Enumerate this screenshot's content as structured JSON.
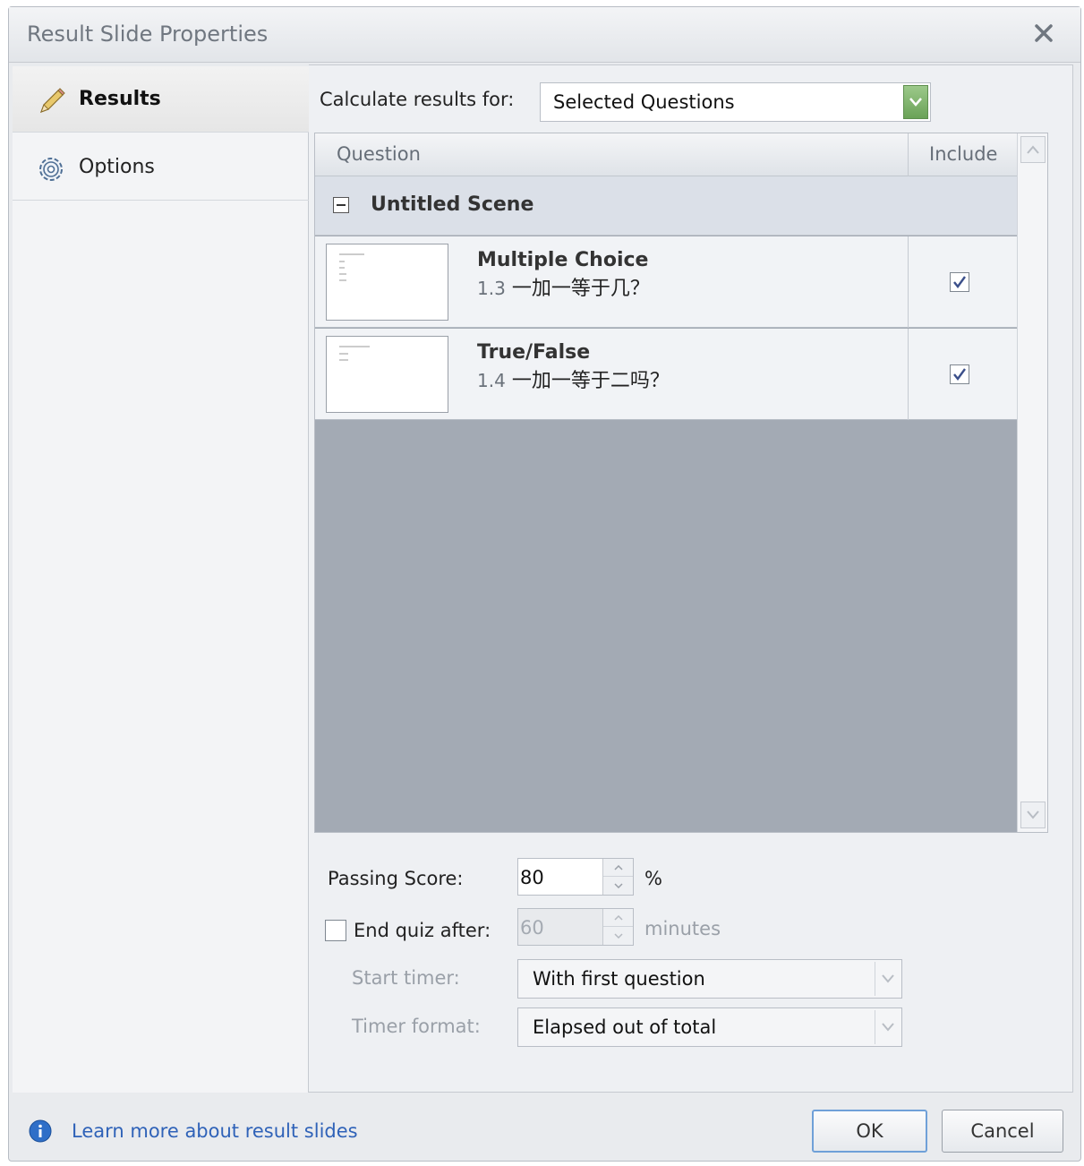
{
  "window": {
    "title": "Result Slide Properties"
  },
  "sidebar": {
    "items": [
      {
        "label": "Results",
        "icon": "pencil-icon",
        "active": true
      },
      {
        "label": "Options",
        "icon": "gear-icon",
        "active": false
      }
    ]
  },
  "calculate": {
    "label": "Calculate results for:",
    "value": "Selected Questions"
  },
  "grid": {
    "columns": [
      "Question",
      "Include"
    ],
    "scene": "Untitled Scene",
    "rows": [
      {
        "type": "Multiple Choice",
        "number": "1.3",
        "text": "一加一等于几？",
        "included": true
      },
      {
        "type": "True/False",
        "number": "1.4",
        "text": "一加一等于二吗？",
        "included": true
      }
    ]
  },
  "passing": {
    "label": "Passing Score:",
    "value": "80",
    "unit": "%"
  },
  "end_quiz": {
    "label": "End quiz after:",
    "checked": false,
    "value": "60",
    "unit": "minutes"
  },
  "start_timer": {
    "label": "Start timer:",
    "value": "With first question"
  },
  "timer_format": {
    "label": "Timer format:",
    "value": "Elapsed out of total"
  },
  "footer": {
    "link": "Learn more about result slides",
    "ok": "OK",
    "cancel": "Cancel"
  },
  "colors": {
    "accent": "#6fa0d8",
    "link": "#2f62b8",
    "grid_empty": "#a3aab4",
    "dropdown_green": "#7fb069"
  }
}
